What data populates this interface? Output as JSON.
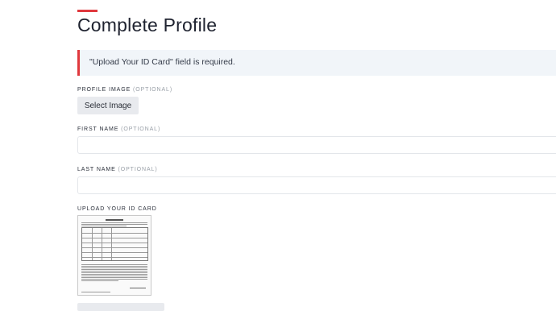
{
  "page": {
    "title": "Complete Profile",
    "accent_color": "#e0393e"
  },
  "alert": {
    "message": "\"Upload Your ID Card\" field is required."
  },
  "fields": {
    "profile_image": {
      "label": "PROFILE IMAGE",
      "optional": "(OPTIONAL)",
      "button": "Select Image"
    },
    "first_name": {
      "label": "FIRST NAME",
      "optional": "(OPTIONAL)",
      "value": ""
    },
    "last_name": {
      "label": "LAST NAME",
      "optional": "(OPTIONAL)",
      "value": ""
    },
    "id_card": {
      "label": "UPLOAD YOUR ID CARD",
      "thumbnail_icon": "document-thumbnail"
    }
  }
}
